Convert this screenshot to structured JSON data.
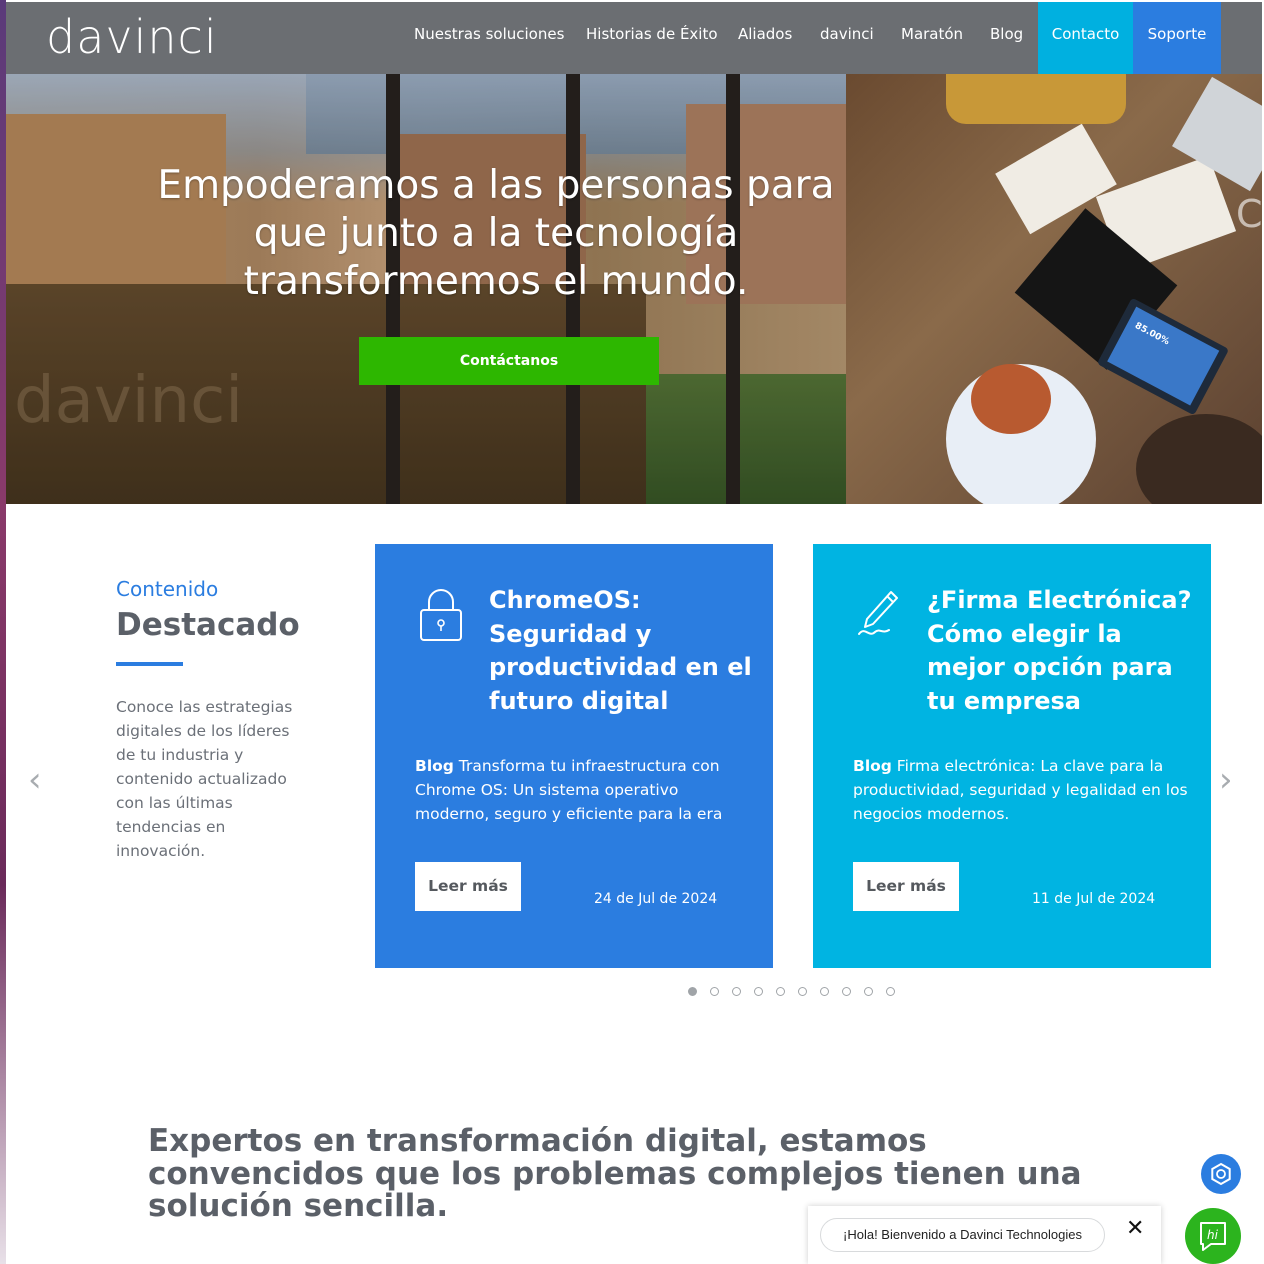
{
  "header": {
    "logo": "davinci",
    "nav": [
      {
        "label": "Nuestras soluciones"
      },
      {
        "label": "Historias de Éxito"
      },
      {
        "label": "Aliados"
      },
      {
        "label": "davinci"
      },
      {
        "label": "Maratón"
      },
      {
        "label": "Blog"
      },
      {
        "label": "Contacto"
      },
      {
        "label": "Soporte"
      }
    ],
    "colors": {
      "bar": "#6b6e72",
      "contact": "#00b0e0",
      "support": "#2b7de0"
    }
  },
  "hero": {
    "title": "Empoderamos a las personas para que junto a la tecnología transformemos el mundo.",
    "button": "Contáctanos",
    "button_color": "#2db700",
    "background_text": "davinci",
    "tablet_text": "85.00%"
  },
  "featured": {
    "label": "Contenido",
    "title": "Destacado",
    "description": "Conoce las estrategias digitales de los líderes de tu industria y contenido actualizado con las últimas tendencias en innovación.",
    "prev_icon": "chevron-left-icon",
    "next_icon": "chevron-right-icon",
    "cards": [
      {
        "icon": "padlock-icon",
        "title": "ChromeOS: Seguridad y productividad en el futuro digital",
        "tag": "Blog",
        "excerpt": " Transforma tu infraestructura con Chrome OS: Un sistema operativo moderno, seguro y eficiente para la era",
        "button": "Leer más",
        "date": "24 de Jul de 2024",
        "color": "#2b7de0"
      },
      {
        "icon": "pen-signature-icon",
        "title": "¿Firma Electrónica? Cómo elegir la mejor opción para tu empresa",
        "tag": "Blog",
        "excerpt": " Firma electrónica: La clave para la productividad, seguridad y legalidad en los negocios modernos.",
        "button": "Leer más",
        "date": "11 de Jul de 2024",
        "color": "#00b4e2"
      }
    ],
    "dots_total": 10,
    "dots_active": 1
  },
  "intro": {
    "title": "Expertos en transformación digital, estamos convencidos que los problemas complejos tienen una solución sencilla."
  },
  "chat": {
    "greeting": "¡Hola! Bienvenido a Davinci Technologies",
    "close_icon": "close-icon",
    "chat_icon": "hi-chat-icon",
    "support_icon": "hexagon-support-icon"
  }
}
